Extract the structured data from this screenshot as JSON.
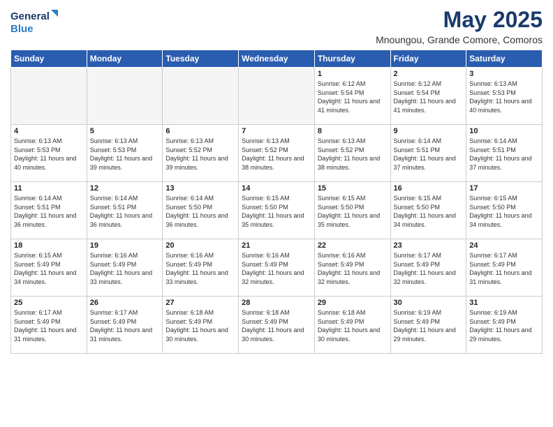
{
  "header": {
    "logo_line1": "General",
    "logo_line2": "Blue",
    "month": "May 2025",
    "location": "Mnoungou, Grande Comore, Comoros"
  },
  "weekdays": [
    "Sunday",
    "Monday",
    "Tuesday",
    "Wednesday",
    "Thursday",
    "Friday",
    "Saturday"
  ],
  "weeks": [
    [
      {
        "day": "",
        "info": ""
      },
      {
        "day": "",
        "info": ""
      },
      {
        "day": "",
        "info": ""
      },
      {
        "day": "",
        "info": ""
      },
      {
        "day": "1",
        "info": "Sunrise: 6:12 AM\nSunset: 5:54 PM\nDaylight: 11 hours\nand 41 minutes."
      },
      {
        "day": "2",
        "info": "Sunrise: 6:12 AM\nSunset: 5:54 PM\nDaylight: 11 hours\nand 41 minutes."
      },
      {
        "day": "3",
        "info": "Sunrise: 6:13 AM\nSunset: 5:53 PM\nDaylight: 11 hours\nand 40 minutes."
      }
    ],
    [
      {
        "day": "4",
        "info": "Sunrise: 6:13 AM\nSunset: 5:53 PM\nDaylight: 11 hours\nand 40 minutes."
      },
      {
        "day": "5",
        "info": "Sunrise: 6:13 AM\nSunset: 5:53 PM\nDaylight: 11 hours\nand 39 minutes."
      },
      {
        "day": "6",
        "info": "Sunrise: 6:13 AM\nSunset: 5:52 PM\nDaylight: 11 hours\nand 39 minutes."
      },
      {
        "day": "7",
        "info": "Sunrise: 6:13 AM\nSunset: 5:52 PM\nDaylight: 11 hours\nand 38 minutes."
      },
      {
        "day": "8",
        "info": "Sunrise: 6:13 AM\nSunset: 5:52 PM\nDaylight: 11 hours\nand 38 minutes."
      },
      {
        "day": "9",
        "info": "Sunrise: 6:14 AM\nSunset: 5:51 PM\nDaylight: 11 hours\nand 37 minutes."
      },
      {
        "day": "10",
        "info": "Sunrise: 6:14 AM\nSunset: 5:51 PM\nDaylight: 11 hours\nand 37 minutes."
      }
    ],
    [
      {
        "day": "11",
        "info": "Sunrise: 6:14 AM\nSunset: 5:51 PM\nDaylight: 11 hours\nand 36 minutes."
      },
      {
        "day": "12",
        "info": "Sunrise: 6:14 AM\nSunset: 5:51 PM\nDaylight: 11 hours\nand 36 minutes."
      },
      {
        "day": "13",
        "info": "Sunrise: 6:14 AM\nSunset: 5:50 PM\nDaylight: 11 hours\nand 36 minutes."
      },
      {
        "day": "14",
        "info": "Sunrise: 6:15 AM\nSunset: 5:50 PM\nDaylight: 11 hours\nand 35 minutes."
      },
      {
        "day": "15",
        "info": "Sunrise: 6:15 AM\nSunset: 5:50 PM\nDaylight: 11 hours\nand 35 minutes."
      },
      {
        "day": "16",
        "info": "Sunrise: 6:15 AM\nSunset: 5:50 PM\nDaylight: 11 hours\nand 34 minutes."
      },
      {
        "day": "17",
        "info": "Sunrise: 6:15 AM\nSunset: 5:50 PM\nDaylight: 11 hours\nand 34 minutes."
      }
    ],
    [
      {
        "day": "18",
        "info": "Sunrise: 6:15 AM\nSunset: 5:49 PM\nDaylight: 11 hours\nand 34 minutes."
      },
      {
        "day": "19",
        "info": "Sunrise: 6:16 AM\nSunset: 5:49 PM\nDaylight: 11 hours\nand 33 minutes."
      },
      {
        "day": "20",
        "info": "Sunrise: 6:16 AM\nSunset: 5:49 PM\nDaylight: 11 hours\nand 33 minutes."
      },
      {
        "day": "21",
        "info": "Sunrise: 6:16 AM\nSunset: 5:49 PM\nDaylight: 11 hours\nand 32 minutes."
      },
      {
        "day": "22",
        "info": "Sunrise: 6:16 AM\nSunset: 5:49 PM\nDaylight: 11 hours\nand 32 minutes."
      },
      {
        "day": "23",
        "info": "Sunrise: 6:17 AM\nSunset: 5:49 PM\nDaylight: 11 hours\nand 32 minutes."
      },
      {
        "day": "24",
        "info": "Sunrise: 6:17 AM\nSunset: 5:49 PM\nDaylight: 11 hours\nand 31 minutes."
      }
    ],
    [
      {
        "day": "25",
        "info": "Sunrise: 6:17 AM\nSunset: 5:49 PM\nDaylight: 11 hours\nand 31 minutes."
      },
      {
        "day": "26",
        "info": "Sunrise: 6:17 AM\nSunset: 5:49 PM\nDaylight: 11 hours\nand 31 minutes."
      },
      {
        "day": "27",
        "info": "Sunrise: 6:18 AM\nSunset: 5:49 PM\nDaylight: 11 hours\nand 30 minutes."
      },
      {
        "day": "28",
        "info": "Sunrise: 6:18 AM\nSunset: 5:49 PM\nDaylight: 11 hours\nand 30 minutes."
      },
      {
        "day": "29",
        "info": "Sunrise: 6:18 AM\nSunset: 5:49 PM\nDaylight: 11 hours\nand 30 minutes."
      },
      {
        "day": "30",
        "info": "Sunrise: 6:19 AM\nSunset: 5:49 PM\nDaylight: 11 hours\nand 29 minutes."
      },
      {
        "day": "31",
        "info": "Sunrise: 6:19 AM\nSunset: 5:49 PM\nDaylight: 11 hours\nand 29 minutes."
      }
    ]
  ]
}
